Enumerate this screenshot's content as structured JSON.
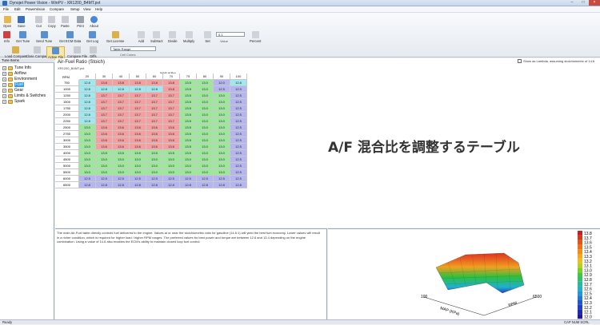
{
  "window": {
    "title": "Dynojet Power Vision - WinPV - XR1200_B4MT.pvt"
  },
  "menu": [
    "File",
    "Edit",
    "PowerVision",
    "Compare",
    "Setup",
    "View",
    "Help"
  ],
  "toolbar": {
    "buttons": [
      "Open",
      "Save",
      "Cut",
      "Copy",
      "Paste",
      "Print",
      "About",
      "Info",
      "Get Tune",
      "Send Tune",
      "Get ECM Data",
      "Get Log",
      "Get License",
      "Add",
      "Subtract",
      "Divide",
      "Multiply",
      "Set",
      "Value",
      "Percent"
    ],
    "value_field": "0.1",
    "row3_buttons": [
      "Load Compare",
      "Close Compare",
      "Active File",
      "Compare File",
      "Diffs"
    ],
    "table_range": "Table Range",
    "cell_colors": "Cell Colors"
  },
  "tree": {
    "header": "Tune Items",
    "items": [
      "Tune Info",
      "Airflow",
      "Environment",
      "Fuel",
      "Gear",
      "Limits & Switches",
      "Spark"
    ],
    "selected": "Fuel"
  },
  "table": {
    "title": "Air-Fuel Ratio (Stoich)",
    "filename": "XR1200_B4MT.pvt",
    "lambda_label": "Show as Lambda, assuming stoichiometric of 14.6",
    "axis_label": "MAP (KPa)",
    "row_axis": "RPM",
    "columns": [
      "20",
      "30",
      "40",
      "50",
      "60",
      "70",
      "75",
      "80",
      "90",
      "100"
    ],
    "rows": [
      {
        "rpm": "750",
        "v": [
          "12.8",
          "13.8",
          "13.8",
          "13.8",
          "13.8",
          "13.8",
          "13.5",
          "13.0",
          "12.0",
          "12.8"
        ]
      },
      {
        "rpm": "1000",
        "v": [
          "12.8",
          "12.8",
          "12.8",
          "12.8",
          "12.8",
          "13.8",
          "13.5",
          "13.0",
          "12.5",
          "12.5"
        ]
      },
      {
        "rpm": "1250",
        "v": [
          "12.8",
          "13.7",
          "13.7",
          "13.7",
          "13.7",
          "13.7",
          "13.5",
          "13.0",
          "13.0",
          "12.5"
        ]
      },
      {
        "rpm": "1500",
        "v": [
          "12.8",
          "13.7",
          "13.7",
          "13.7",
          "13.7",
          "13.7",
          "13.5",
          "13.0",
          "13.0",
          "12.5"
        ]
      },
      {
        "rpm": "1750",
        "v": [
          "12.8",
          "13.7",
          "13.7",
          "13.7",
          "13.7",
          "13.7",
          "13.5",
          "13.0",
          "13.0",
          "12.5"
        ]
      },
      {
        "rpm": "2000",
        "v": [
          "12.8",
          "13.7",
          "13.7",
          "13.7",
          "13.7",
          "13.7",
          "13.5",
          "13.0",
          "13.0",
          "12.5"
        ]
      },
      {
        "rpm": "2250",
        "v": [
          "12.8",
          "13.7",
          "13.7",
          "13.7",
          "13.7",
          "13.7",
          "13.5",
          "13.0",
          "13.0",
          "12.5"
        ]
      },
      {
        "rpm": "2500",
        "v": [
          "13.0",
          "13.6",
          "13.6",
          "13.6",
          "13.6",
          "13.6",
          "13.5",
          "13.0",
          "13.0",
          "12.5"
        ]
      },
      {
        "rpm": "2750",
        "v": [
          "13.0",
          "13.6",
          "13.6",
          "13.6",
          "13.6",
          "13.6",
          "13.5",
          "13.0",
          "13.0",
          "12.5"
        ]
      },
      {
        "rpm": "3000",
        "v": [
          "13.0",
          "13.6",
          "13.6",
          "13.6",
          "13.6",
          "13.6",
          "13.5",
          "13.0",
          "13.0",
          "12.5"
        ]
      },
      {
        "rpm": "3500",
        "v": [
          "13.0",
          "13.6",
          "13.6",
          "13.6",
          "13.6",
          "13.6",
          "13.5",
          "13.0",
          "13.0",
          "12.5"
        ]
      },
      {
        "rpm": "4000",
        "v": [
          "13.0",
          "13.5",
          "13.5",
          "13.5",
          "13.5",
          "13.5",
          "13.5",
          "13.0",
          "13.0",
          "12.5"
        ]
      },
      {
        "rpm": "4500",
        "v": [
          "13.0",
          "13.0",
          "13.0",
          "13.0",
          "13.0",
          "13.0",
          "13.0",
          "13.0",
          "13.0",
          "12.5"
        ]
      },
      {
        "rpm": "5000",
        "v": [
          "13.0",
          "13.0",
          "13.0",
          "13.0",
          "13.0",
          "13.0",
          "13.0",
          "13.0",
          "13.0",
          "12.5"
        ]
      },
      {
        "rpm": "5500",
        "v": [
          "13.0",
          "13.0",
          "13.0",
          "13.0",
          "13.0",
          "13.0",
          "13.0",
          "13.0",
          "13.0",
          "12.5"
        ]
      },
      {
        "rpm": "6000",
        "v": [
          "12.5",
          "12.5",
          "12.5",
          "12.5",
          "12.5",
          "12.5",
          "12.5",
          "12.5",
          "12.5",
          "12.5"
        ]
      },
      {
        "rpm": "6500",
        "v": [
          "12.8",
          "12.8",
          "12.8",
          "12.8",
          "12.8",
          "12.8",
          "12.8",
          "12.8",
          "12.8",
          "12.8"
        ]
      }
    ]
  },
  "overlay_caption": "A/F 混合比を調整するテーブル",
  "description": "The main Air-Fuel table directly controls fuel delivered to the engine. Values at or near the stoichiometric ratio for gasoline (14.6:1) will yield the best fuel economy. Lower values will result in a richer condition, which is required for higher load / higher RPM ranges. The preferred values for best power and torque are between 12.6 and 13.4 depending on the engine combination. Using a value of 14.6 also enables the ECM's ability to maintain closed loop fuel control.",
  "plot": {
    "legend": [
      "13.8",
      "13.7",
      "13.6",
      "13.5",
      "13.4",
      "13.3",
      "13.2",
      "13.1",
      "13.0",
      "12.9",
      "12.8",
      "12.7",
      "12.6",
      "12.5",
      "12.4",
      "12.3",
      "12.2",
      "12.1",
      "12.0"
    ],
    "x_axis_label": "MAP (KPa)",
    "y_axis_label": "RPM",
    "tick_left": "100",
    "tick_right": "6500"
  },
  "status": {
    "left": "Ready",
    "right": "CAP NUM SCRL"
  },
  "colors": {
    "red": "#f4a0a0",
    "green": "#9be89b",
    "cyan": "#9ee8ee",
    "blue": "#b5b5f0",
    "selection": "#3399ff"
  }
}
